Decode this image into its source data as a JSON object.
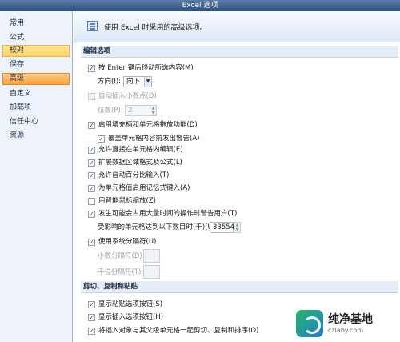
{
  "window": {
    "title": "Excel 选项"
  },
  "sidebar": {
    "items": [
      {
        "label": "常用"
      },
      {
        "label": "公式"
      },
      {
        "label": "校对"
      },
      {
        "label": "保存"
      },
      {
        "label": "高级"
      },
      {
        "label": "自定义"
      },
      {
        "label": "加载项"
      },
      {
        "label": "信任中心"
      },
      {
        "label": "资源"
      }
    ],
    "highlighted": "校对",
    "selected": "高级"
  },
  "header": {
    "text": "使用 Excel 时采用的高级选项。",
    "icon": "settings-list-icon"
  },
  "sections": {
    "edit": {
      "title": "编辑选项"
    },
    "cut": {
      "title": "剪切、复制和粘贴"
    }
  },
  "options": {
    "move_after_enter": {
      "label": "按 Enter 键后移动所选内容(M)",
      "checked": true
    },
    "direction": {
      "label": "方向(I):",
      "value": "向下"
    },
    "auto_decimal": {
      "label": "自动插入小数点(D)",
      "checked": false
    },
    "places": {
      "label": "位数(P):",
      "value": "2"
    },
    "fill_handle": {
      "label": "启用填充柄和单元格拖放功能(D)",
      "checked": true
    },
    "alert_overwrite": {
      "label": "覆盖单元格内容前发出警告(A)",
      "checked": true
    },
    "edit_in_cell": {
      "label": "允许直接在单元格内编辑(E)",
      "checked": true
    },
    "extend_formats": {
      "label": "扩展数据区域格式及公式(L)",
      "checked": true
    },
    "auto_percent": {
      "label": "允许自动百分比输入(T)",
      "checked": true
    },
    "autocomplete": {
      "label": "为单元格值启用记忆式键入(A)",
      "checked": true
    },
    "intellimouse": {
      "label": "用智能鼠标缩放(Z)",
      "checked": false
    },
    "alert_slow": {
      "label": "发生可能会占用大量时间的操作时警告用户(T)",
      "checked": true
    },
    "cells_threshold": {
      "label": "受影响的单元格达到以下数目时(千)(U):",
      "value": "33554"
    },
    "system_separators": {
      "label": "使用系统分隔符(U)",
      "checked": true
    },
    "decimal_sep": {
      "label": "小数分隔符(D):",
      "value": ""
    },
    "thousands_sep": {
      "label": "千位分隔符(T):",
      "value": ""
    },
    "show_paste_options": {
      "label": "显示粘贴选项按钮(S)",
      "checked": true
    },
    "show_insert_options": {
      "label": "显示插入选项按钮(H)",
      "checked": true
    },
    "cut_copy_sort": {
      "label": "将插入对象与其父级单元格一起剪切、复制和排序(O)",
      "checked": true
    }
  },
  "watermark": {
    "title": "纯净基地",
    "subtitle": "czlaby.com"
  }
}
